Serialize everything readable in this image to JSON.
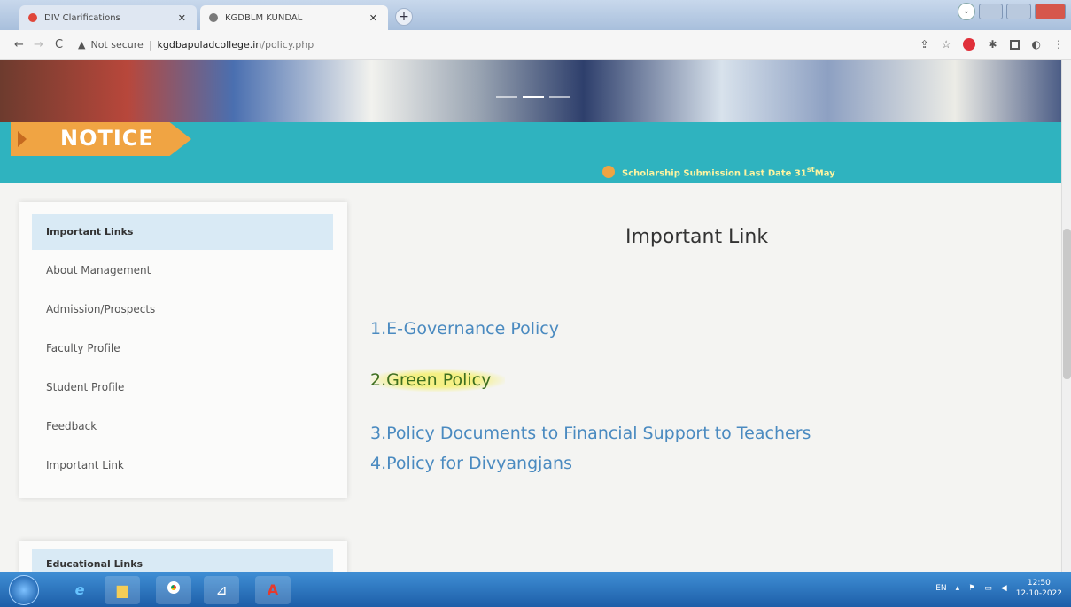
{
  "browser": {
    "tabs": [
      {
        "label": "DIV Clarifications",
        "active": false
      },
      {
        "label": "KGDBLM KUNDAL",
        "active": true
      }
    ],
    "security_label": "Not secure",
    "url_host": "kgdbapuladcollege.in",
    "url_path": "/policy.php"
  },
  "notice": {
    "title": "NOTICE",
    "ticker_text": "Scholarship Submission Last Date 31",
    "ticker_sup": "st",
    "ticker_suffix": "May"
  },
  "sidebar": {
    "heading": "Important Links",
    "items": [
      {
        "label": "About Management"
      },
      {
        "label": "Admission/Prospects"
      },
      {
        "label": "Faculty Profile"
      },
      {
        "label": "Student Profile"
      },
      {
        "label": "Feedback"
      },
      {
        "label": "Important Link"
      }
    ],
    "second_heading": "Educational Links"
  },
  "main": {
    "title": "Important Link",
    "links": [
      {
        "label": "1.E-Governance Policy"
      },
      {
        "label": "2.Green Policy"
      },
      {
        "label": "3.Policy Documents to Financial Support to Teachers"
      },
      {
        "label": "4.Policy for Divyangjans"
      }
    ]
  },
  "taskbar": {
    "lang": "EN",
    "time": "12:50",
    "date": "12-10-2022"
  },
  "colors": {
    "notice_bar": "#2fb3bf",
    "notice_tag": "#f0a443",
    "link": "#4a8ac0",
    "sidebar_head": "#d9eaf5"
  }
}
